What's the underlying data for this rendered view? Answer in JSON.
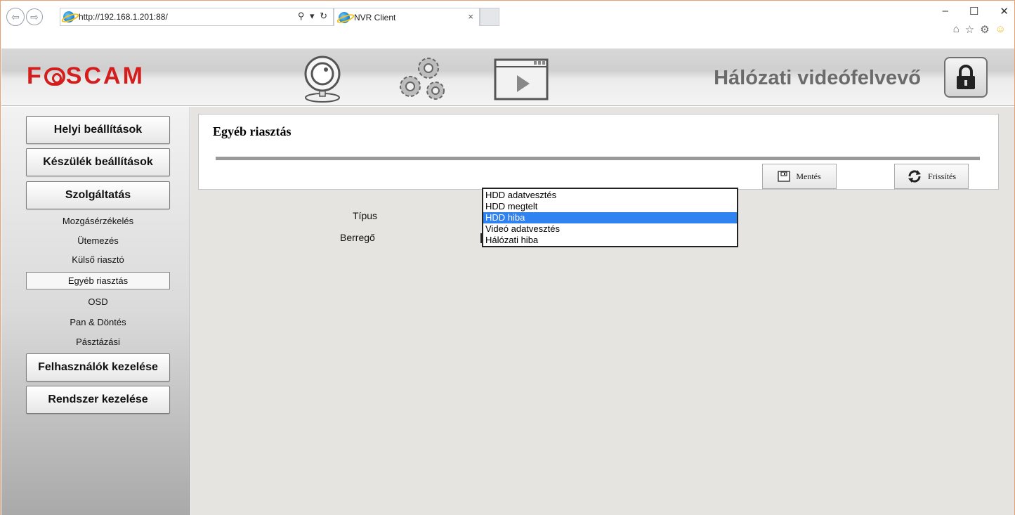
{
  "browser": {
    "url": "http://192.168.1.201:88/",
    "addr_tools": "⚲ ▾ ↻",
    "tab_title": "NVR Client",
    "tab_close": "×",
    "window_controls": {
      "minimize": "–",
      "maximize": "☐",
      "close": "✕"
    },
    "toolbar_icons": {
      "home": "⌂",
      "favorites": "☆",
      "settings": "⚙",
      "feedback": "☺"
    }
  },
  "header": {
    "logo_left": "F",
    "logo_right": "SCAM",
    "title": "Hálózati videófelvevő",
    "icons": [
      "camera-icon",
      "gears-icon",
      "playback-icon",
      "lock-icon"
    ],
    "logo_color": "#d41e1e"
  },
  "sidebar": {
    "items": [
      {
        "label": "Helyi beállítások"
      },
      {
        "label": "Készülék beállítások"
      },
      {
        "label": "Szolgáltatás"
      }
    ],
    "sub_items": [
      {
        "label": "Mozgásérzékelés"
      },
      {
        "label": "Ütemezés"
      },
      {
        "label": "Külső riasztó"
      },
      {
        "label": "Egyéb riasztás",
        "active": true
      },
      {
        "label": "OSD"
      },
      {
        "label": "Pan & Döntés"
      },
      {
        "label": "Pásztázási"
      }
    ],
    "bottom_items": [
      {
        "label": "Felhasználók kezelése"
      },
      {
        "label": "Rendszer kezelése"
      }
    ]
  },
  "main": {
    "title": "Egyéb riasztás",
    "save_label": "Mentés",
    "refresh_label": "Frissítés",
    "type_label": "Típus",
    "buzzer_label": "Berregő",
    "type_options": [
      {
        "label": "HDD adatvesztés",
        "selected": false
      },
      {
        "label": "HDD megtelt",
        "selected": false
      },
      {
        "label": "HDD hiba",
        "selected": true
      },
      {
        "label": "Videó adatvesztés",
        "selected": false
      },
      {
        "label": "Hálózati hiba",
        "selected": false
      }
    ],
    "selection_color": "#2f82f0"
  }
}
